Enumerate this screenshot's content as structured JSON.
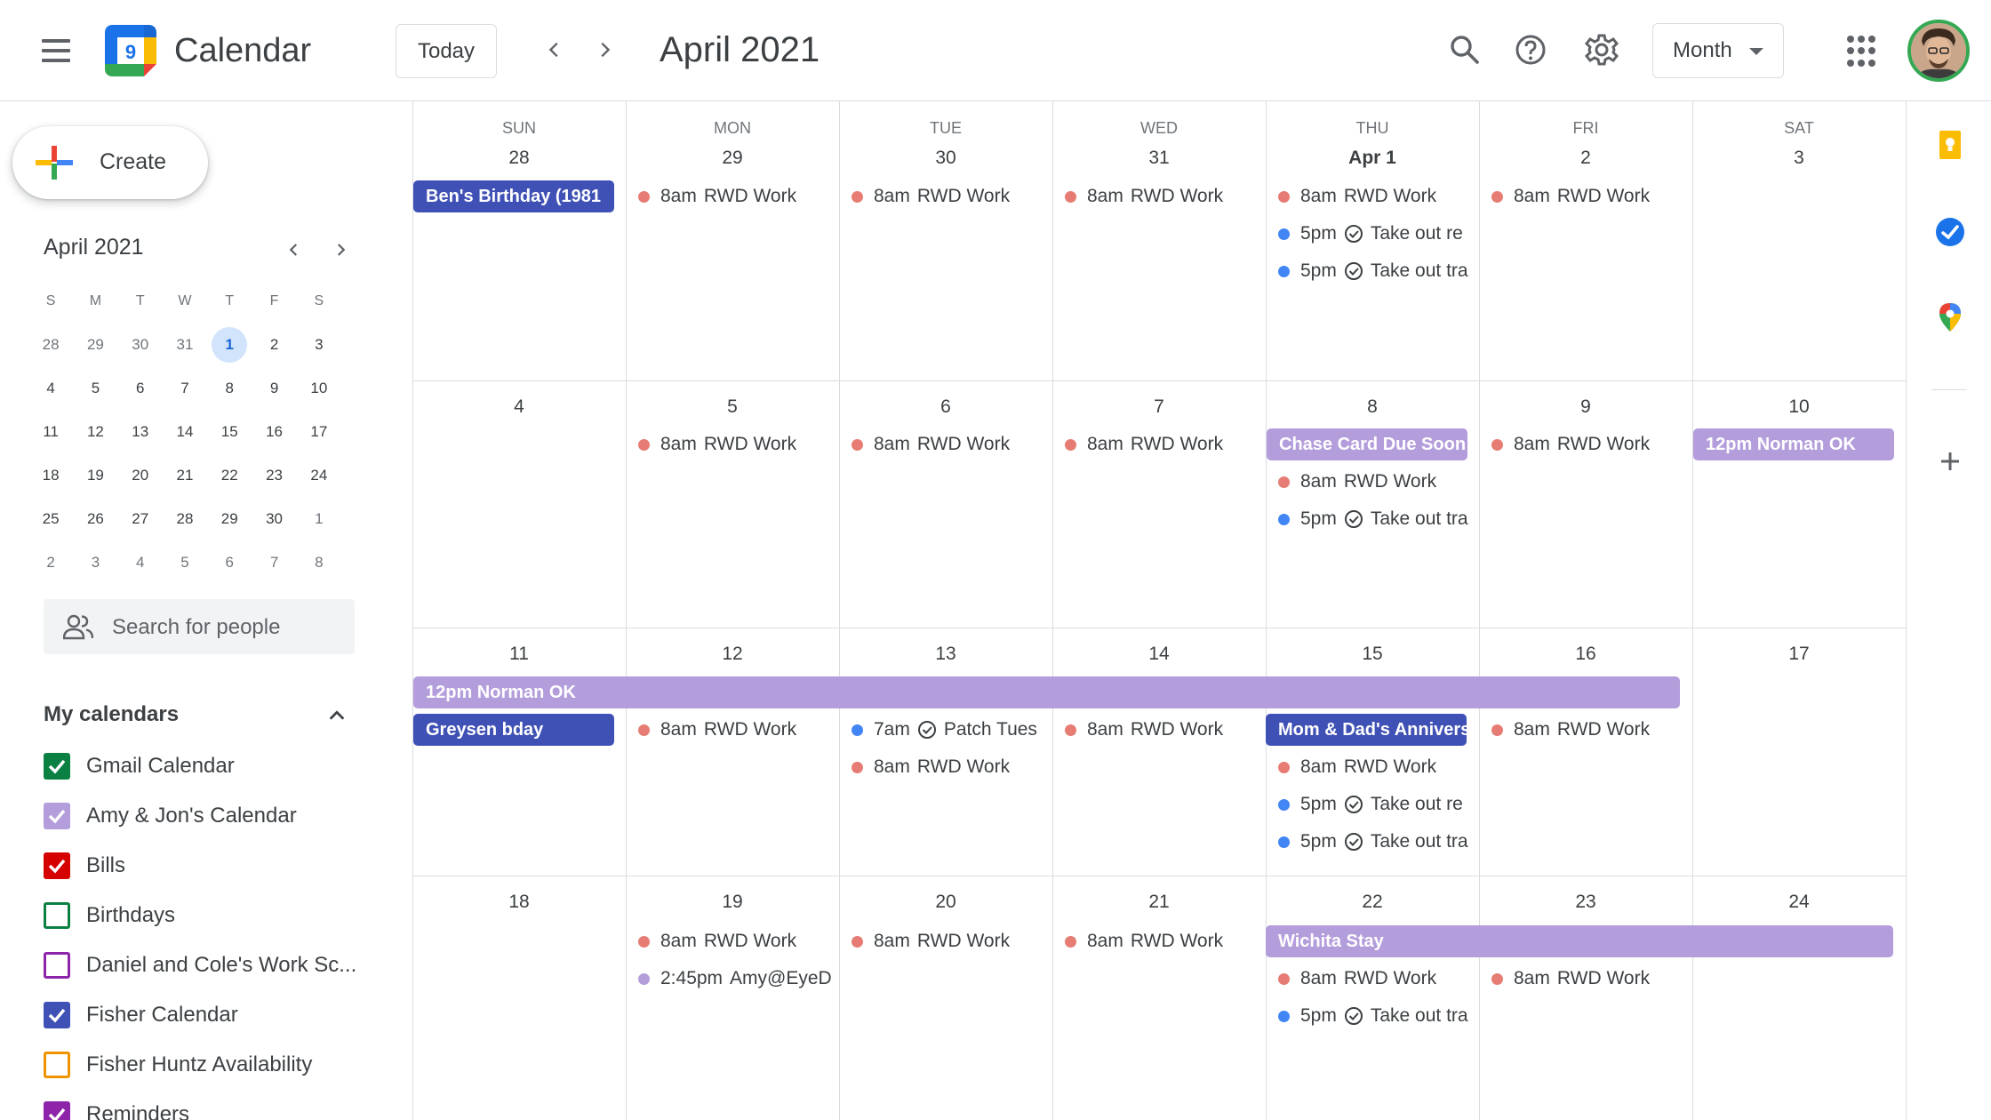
{
  "app": {
    "title": "Calendar",
    "logo_day": "9"
  },
  "toolbar": {
    "today_label": "Today",
    "month_title": "April 2021",
    "view_label": "Month"
  },
  "sidebar": {
    "create_label": "Create",
    "mini_cal": {
      "title": "April 2021",
      "weekday_heads": [
        "S",
        "M",
        "T",
        "W",
        "T",
        "F",
        "S"
      ],
      "weeks": [
        [
          "28",
          "29",
          "30",
          "31",
          "1",
          "2",
          "3"
        ],
        [
          "4",
          "5",
          "6",
          "7",
          "8",
          "9",
          "10"
        ],
        [
          "11",
          "12",
          "13",
          "14",
          "15",
          "16",
          "17"
        ],
        [
          "18",
          "19",
          "20",
          "21",
          "22",
          "23",
          "24"
        ],
        [
          "25",
          "26",
          "27",
          "28",
          "29",
          "30",
          "1"
        ],
        [
          "2",
          "3",
          "4",
          "5",
          "6",
          "7",
          "8"
        ]
      ],
      "today": "1"
    },
    "search_placeholder": "Search for people",
    "my_calendars_title": "My calendars",
    "calendars": [
      {
        "name": "Gmail Calendar",
        "color": "#0b8043",
        "checked": true
      },
      {
        "name": "Amy & Jon's Calendar",
        "color": "#b39ddb",
        "checked": true
      },
      {
        "name": "Bills",
        "color": "#d50000",
        "checked": true
      },
      {
        "name": "Birthdays",
        "color": "#0b8043",
        "checked": false
      },
      {
        "name": "Daniel and Cole's Work Sc...",
        "color": "#8e24aa",
        "checked": false
      },
      {
        "name": "Fisher Calendar",
        "color": "#3f51b5",
        "checked": true
      },
      {
        "name": "Fisher Huntz Availability",
        "color": "#f09300",
        "checked": false
      },
      {
        "name": "Reminders",
        "color": "#8e24aa",
        "checked": true
      }
    ]
  },
  "grid": {
    "weekdays": [
      "SUN",
      "MON",
      "TUE",
      "WED",
      "THU",
      "FRI",
      "SAT"
    ],
    "weeks": [
      [
        "28",
        "29",
        "30",
        "31",
        "Apr 1",
        "2",
        "3"
      ],
      [
        "4",
        "5",
        "6",
        "7",
        "8",
        "9",
        "10"
      ],
      [
        "11",
        "12",
        "13",
        "14",
        "15",
        "16",
        "17"
      ],
      [
        "18",
        "19",
        "20",
        "21",
        "22",
        "23",
        "24"
      ]
    ]
  },
  "events": {
    "chips": [
      {
        "text": "Ben's Birthday (1981",
        "color": "blue"
      },
      {
        "text": "Chase Card Due Soon",
        "color": "lav"
      },
      {
        "text": "12pm Norman OK",
        "color": "lav"
      },
      {
        "text": "12pm Norman OK",
        "color": "lav"
      },
      {
        "text": "Greysen bday",
        "color": "blue"
      },
      {
        "text": "Mom & Dad's Anniversary",
        "color": "blue"
      },
      {
        "text": "Wichita Stay",
        "color": "lav"
      }
    ],
    "timed": [
      {
        "time": "8am",
        "title": "RWD Work",
        "dot": "#e67c73",
        "task": false
      },
      {
        "time": "8am",
        "title": "RWD Work",
        "dot": "#e67c73",
        "task": false
      },
      {
        "time": "8am",
        "title": "RWD Work",
        "dot": "#e67c73",
        "task": false
      },
      {
        "time": "8am",
        "title": "RWD Work",
        "dot": "#e67c73",
        "task": false
      },
      {
        "time": "5pm",
        "title": "Take out re",
        "dot": "#4285f4",
        "task": true
      },
      {
        "time": "5pm",
        "title": "Take out tra",
        "dot": "#4285f4",
        "task": true
      },
      {
        "time": "8am",
        "title": "RWD Work",
        "dot": "#e67c73",
        "task": false
      },
      {
        "time": "8am",
        "title": "RWD Work",
        "dot": "#e67c73",
        "task": false
      },
      {
        "time": "8am",
        "title": "RWD Work",
        "dot": "#e67c73",
        "task": false
      },
      {
        "time": "8am",
        "title": "RWD Work",
        "dot": "#e67c73",
        "task": false
      },
      {
        "time": "8am",
        "title": "RWD Work",
        "dot": "#e67c73",
        "task": false
      },
      {
        "time": "5pm",
        "title": "Take out tra",
        "dot": "#4285f4",
        "task": true
      },
      {
        "time": "8am",
        "title": "RWD Work",
        "dot": "#e67c73",
        "task": false
      },
      {
        "time": "8am",
        "title": "RWD Work",
        "dot": "#e67c73",
        "task": false
      },
      {
        "time": "7am",
        "title": "Patch Tues",
        "dot": "#4285f4",
        "task": true
      },
      {
        "time": "8am",
        "title": "RWD Work",
        "dot": "#e67c73",
        "task": false
      },
      {
        "time": "8am",
        "title": "RWD Work",
        "dot": "#e67c73",
        "task": false
      },
      {
        "time": "8am",
        "title": "RWD Work",
        "dot": "#e67c73",
        "task": false
      },
      {
        "time": "5pm",
        "title": "Take out re",
        "dot": "#4285f4",
        "task": true
      },
      {
        "time": "5pm",
        "title": "Take out tra",
        "dot": "#4285f4",
        "task": true
      },
      {
        "time": "8am",
        "title": "RWD Work",
        "dot": "#e67c73",
        "task": false
      },
      {
        "time": "8am",
        "title": "RWD Work",
        "dot": "#e67c73",
        "task": false
      },
      {
        "time": "2:45pm",
        "title": "Amy@EyeD",
        "dot": "#b39ddb",
        "task": false
      },
      {
        "time": "8am",
        "title": "RWD Work",
        "dot": "#e67c73",
        "task": false
      },
      {
        "time": "8am",
        "title": "RWD Work",
        "dot": "#e67c73",
        "task": false
      },
      {
        "time": "8am",
        "title": "RWD Work",
        "dot": "#e67c73",
        "task": false
      },
      {
        "time": "5pm",
        "title": "Take out tra",
        "dot": "#4285f4",
        "task": true
      },
      {
        "time": "8am",
        "title": "RWD Work",
        "dot": "#e67c73",
        "task": false
      }
    ]
  }
}
